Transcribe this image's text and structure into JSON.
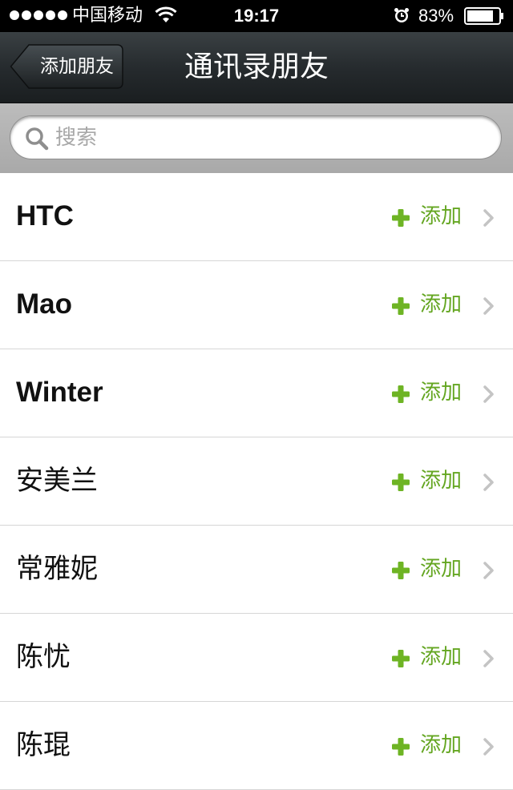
{
  "status_bar": {
    "carrier": "中国移动",
    "time": "19:17",
    "battery_percent": "83%",
    "battery_level": 0.83,
    "icons": [
      "signal-icon",
      "wifi-icon",
      "alarm-icon",
      "battery-icon"
    ]
  },
  "nav": {
    "back_label": "添加朋友",
    "title": "通讯录朋友"
  },
  "search": {
    "placeholder": "搜索",
    "value": ""
  },
  "contacts": [
    {
      "name": "HTC",
      "action": "添加"
    },
    {
      "name": "Mao",
      "action": "添加"
    },
    {
      "name": "Winter",
      "action": "添加"
    },
    {
      "name": "安美兰",
      "action": "添加"
    },
    {
      "name": "常雅妮",
      "action": "添加"
    },
    {
      "name": "陈忧",
      "action": "添加"
    },
    {
      "name": "陈琨",
      "action": "添加"
    }
  ],
  "colors": {
    "accent_green": "#64a621",
    "nav_background": "#262b2e"
  }
}
